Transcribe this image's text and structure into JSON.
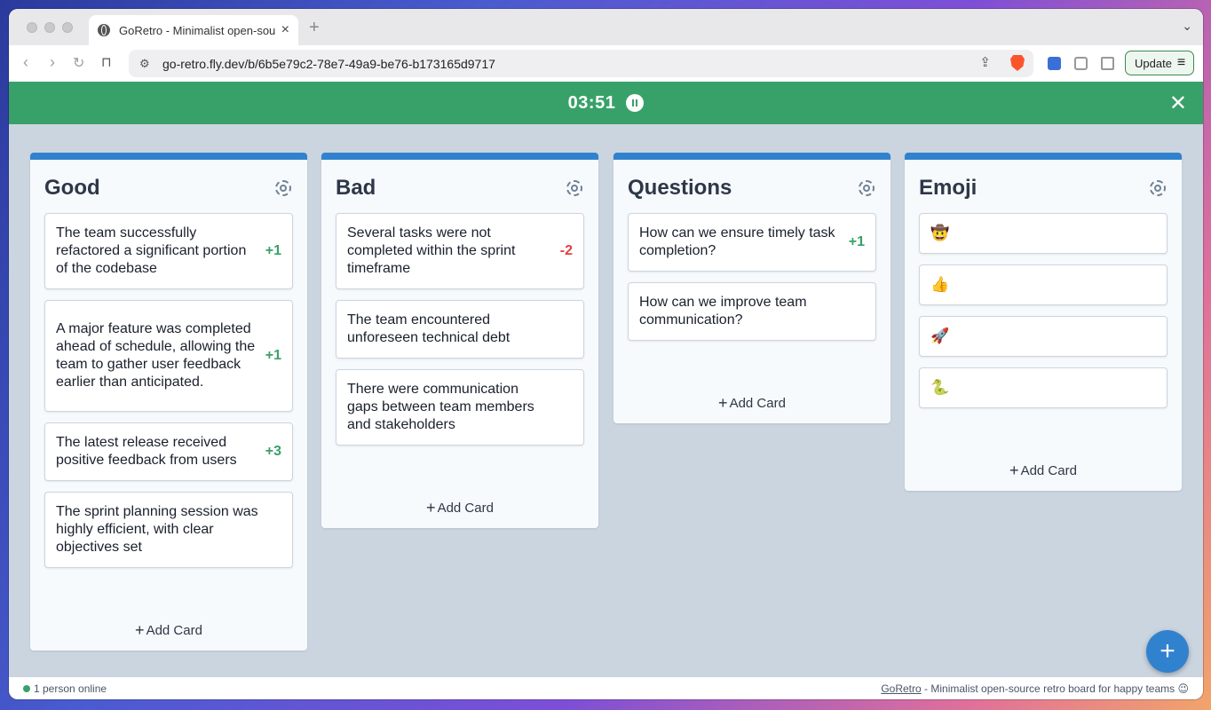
{
  "browser": {
    "tab_title": "GoRetro - Minimalist open-source retro board for happy teams",
    "url": "go-retro.fly.dev/b/6b5e79c2-78e7-49a9-be76-b173165d9717",
    "update_label": "Update"
  },
  "timer": {
    "value": "03:51"
  },
  "columns": [
    {
      "title": "Good",
      "cards": [
        {
          "text": "The team successfully refactored a significant portion of the codebase",
          "votes": "+1"
        },
        {
          "text": "A major feature was completed ahead of schedule, allowing the team to gather user feedback earlier than anticipated.",
          "votes": "+1"
        },
        {
          "text": "The latest release received positive feedback from users",
          "votes": "+3"
        },
        {
          "text": "The sprint planning session was highly efficient, with clear objectives set",
          "votes": ""
        }
      ],
      "add_label": "Add Card"
    },
    {
      "title": "Bad",
      "cards": [
        {
          "text": "Several tasks were not completed within the sprint timeframe",
          "votes": "-2"
        },
        {
          "text": "The team encountered unforeseen technical debt",
          "votes": ""
        },
        {
          "text": "There were communication gaps between team members and stakeholders",
          "votes": ""
        }
      ],
      "add_label": "Add Card"
    },
    {
      "title": "Questions",
      "cards": [
        {
          "text": "How can we ensure timely task completion?",
          "votes": "+1"
        },
        {
          "text": "How can we improve team communication?",
          "votes": ""
        }
      ],
      "add_label": "Add Card"
    },
    {
      "title": "Emoji",
      "cards": [
        {
          "text": "🤠",
          "votes": ""
        },
        {
          "text": "👍",
          "votes": ""
        },
        {
          "text": "🚀",
          "votes": ""
        },
        {
          "text": "🐍",
          "votes": ""
        }
      ],
      "add_label": "Add Card"
    }
  ],
  "footer": {
    "online": "1 person online",
    "brand": "GoRetro",
    "tagline": " - Minimalist open-source retro board for happy teams 😉"
  },
  "colors": {
    "accent": "#3182ce",
    "timer_bar": "#38a169",
    "positive": "#38a169",
    "negative": "#e53e3e"
  }
}
